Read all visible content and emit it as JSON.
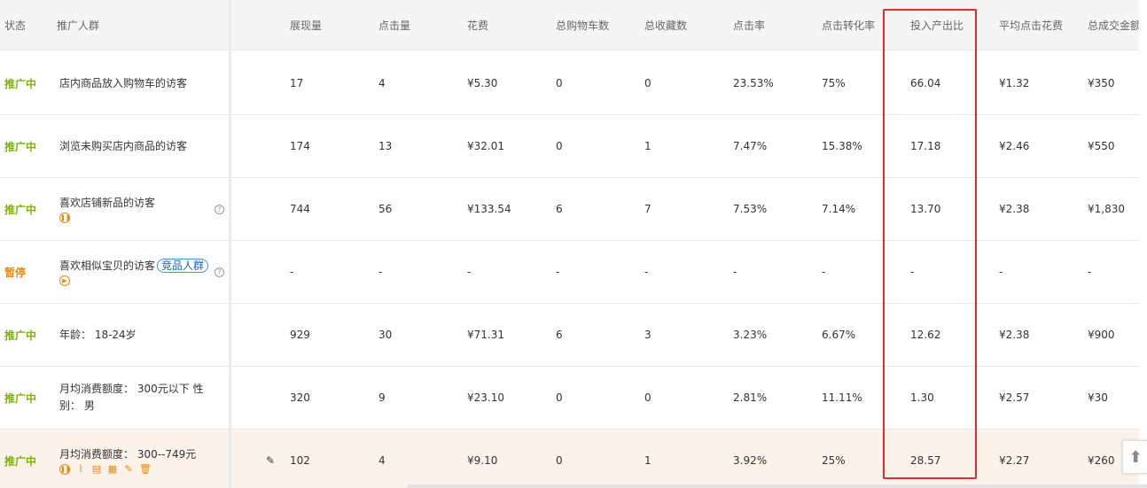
{
  "columns": {
    "status": "状态",
    "crowd": "推广人群",
    "impressions": "展现量",
    "clicks": "点击量",
    "cost": "花费",
    "cart": "总购物车数",
    "favorites": "总收藏数",
    "ctr": "点击率",
    "cvr": "点击转化率",
    "roi": "投入产出比",
    "cpc": "平均点击花费",
    "gmv": "总成交金额"
  },
  "rows": [
    {
      "status": "推广中",
      "crowd": "店内商品放入购物车的访客",
      "impressions": "17",
      "clicks": "4",
      "cost": "¥5.30",
      "cart": "0",
      "favorites": "0",
      "ctr": "23.53%",
      "cvr": "75%",
      "roi": "66.04",
      "cpc": "¥1.32",
      "gmv": "¥350"
    },
    {
      "status": "推广中",
      "crowd": "浏览未购买店内商品的访客",
      "impressions": "174",
      "clicks": "13",
      "cost": "¥32.01",
      "cart": "0",
      "favorites": "1",
      "ctr": "7.47%",
      "cvr": "15.38%",
      "roi": "17.18",
      "cpc": "¥2.46",
      "gmv": "¥550"
    },
    {
      "status": "推广中",
      "crowd": "喜欢店铺新品的访客",
      "impressions": "744",
      "clicks": "56",
      "cost": "¥133.54",
      "cart": "6",
      "favorites": "7",
      "ctr": "7.53%",
      "cvr": "7.14%",
      "roi": "13.70",
      "cpc": "¥2.38",
      "gmv": "¥1,830"
    },
    {
      "status": "暂停",
      "crowd": "喜欢相似宝贝的访客",
      "tag": "竞品人群",
      "impressions": "-",
      "clicks": "-",
      "cost": "-",
      "cart": "-",
      "favorites": "-",
      "ctr": "-",
      "cvr": "-",
      "roi": "-",
      "cpc": "-",
      "gmv": "-"
    },
    {
      "status": "推广中",
      "crowd": "年龄： 18-24岁",
      "impressions": "929",
      "clicks": "30",
      "cost": "¥71.31",
      "cart": "6",
      "favorites": "3",
      "ctr": "3.23%",
      "cvr": "6.67%",
      "roi": "12.62",
      "cpc": "¥2.38",
      "gmv": "¥900"
    },
    {
      "status": "推广中",
      "crowd": "月均消费额度： 300元以下 性别： 男",
      "impressions": "320",
      "clicks": "9",
      "cost": "¥23.10",
      "cart": "0",
      "favorites": "0",
      "ctr": "2.81%",
      "cvr": "11.11%",
      "roi": "1.30",
      "cpc": "¥2.57",
      "gmv": "¥30"
    },
    {
      "status": "推广中",
      "crowd": "月均消费额度： 300--749元",
      "impressions": "102",
      "clicks": "4",
      "cost": "¥9.10",
      "cart": "0",
      "favorites": "1",
      "ctr": "3.92%",
      "cvr": "25%",
      "roi": "28.57",
      "cpc": "¥2.27",
      "gmv": "¥260"
    }
  ],
  "colors": {
    "active": "#7cb305",
    "paused": "#e8890c",
    "highlight_box": "#d9302c",
    "row_hover": "#fbf2ea"
  }
}
